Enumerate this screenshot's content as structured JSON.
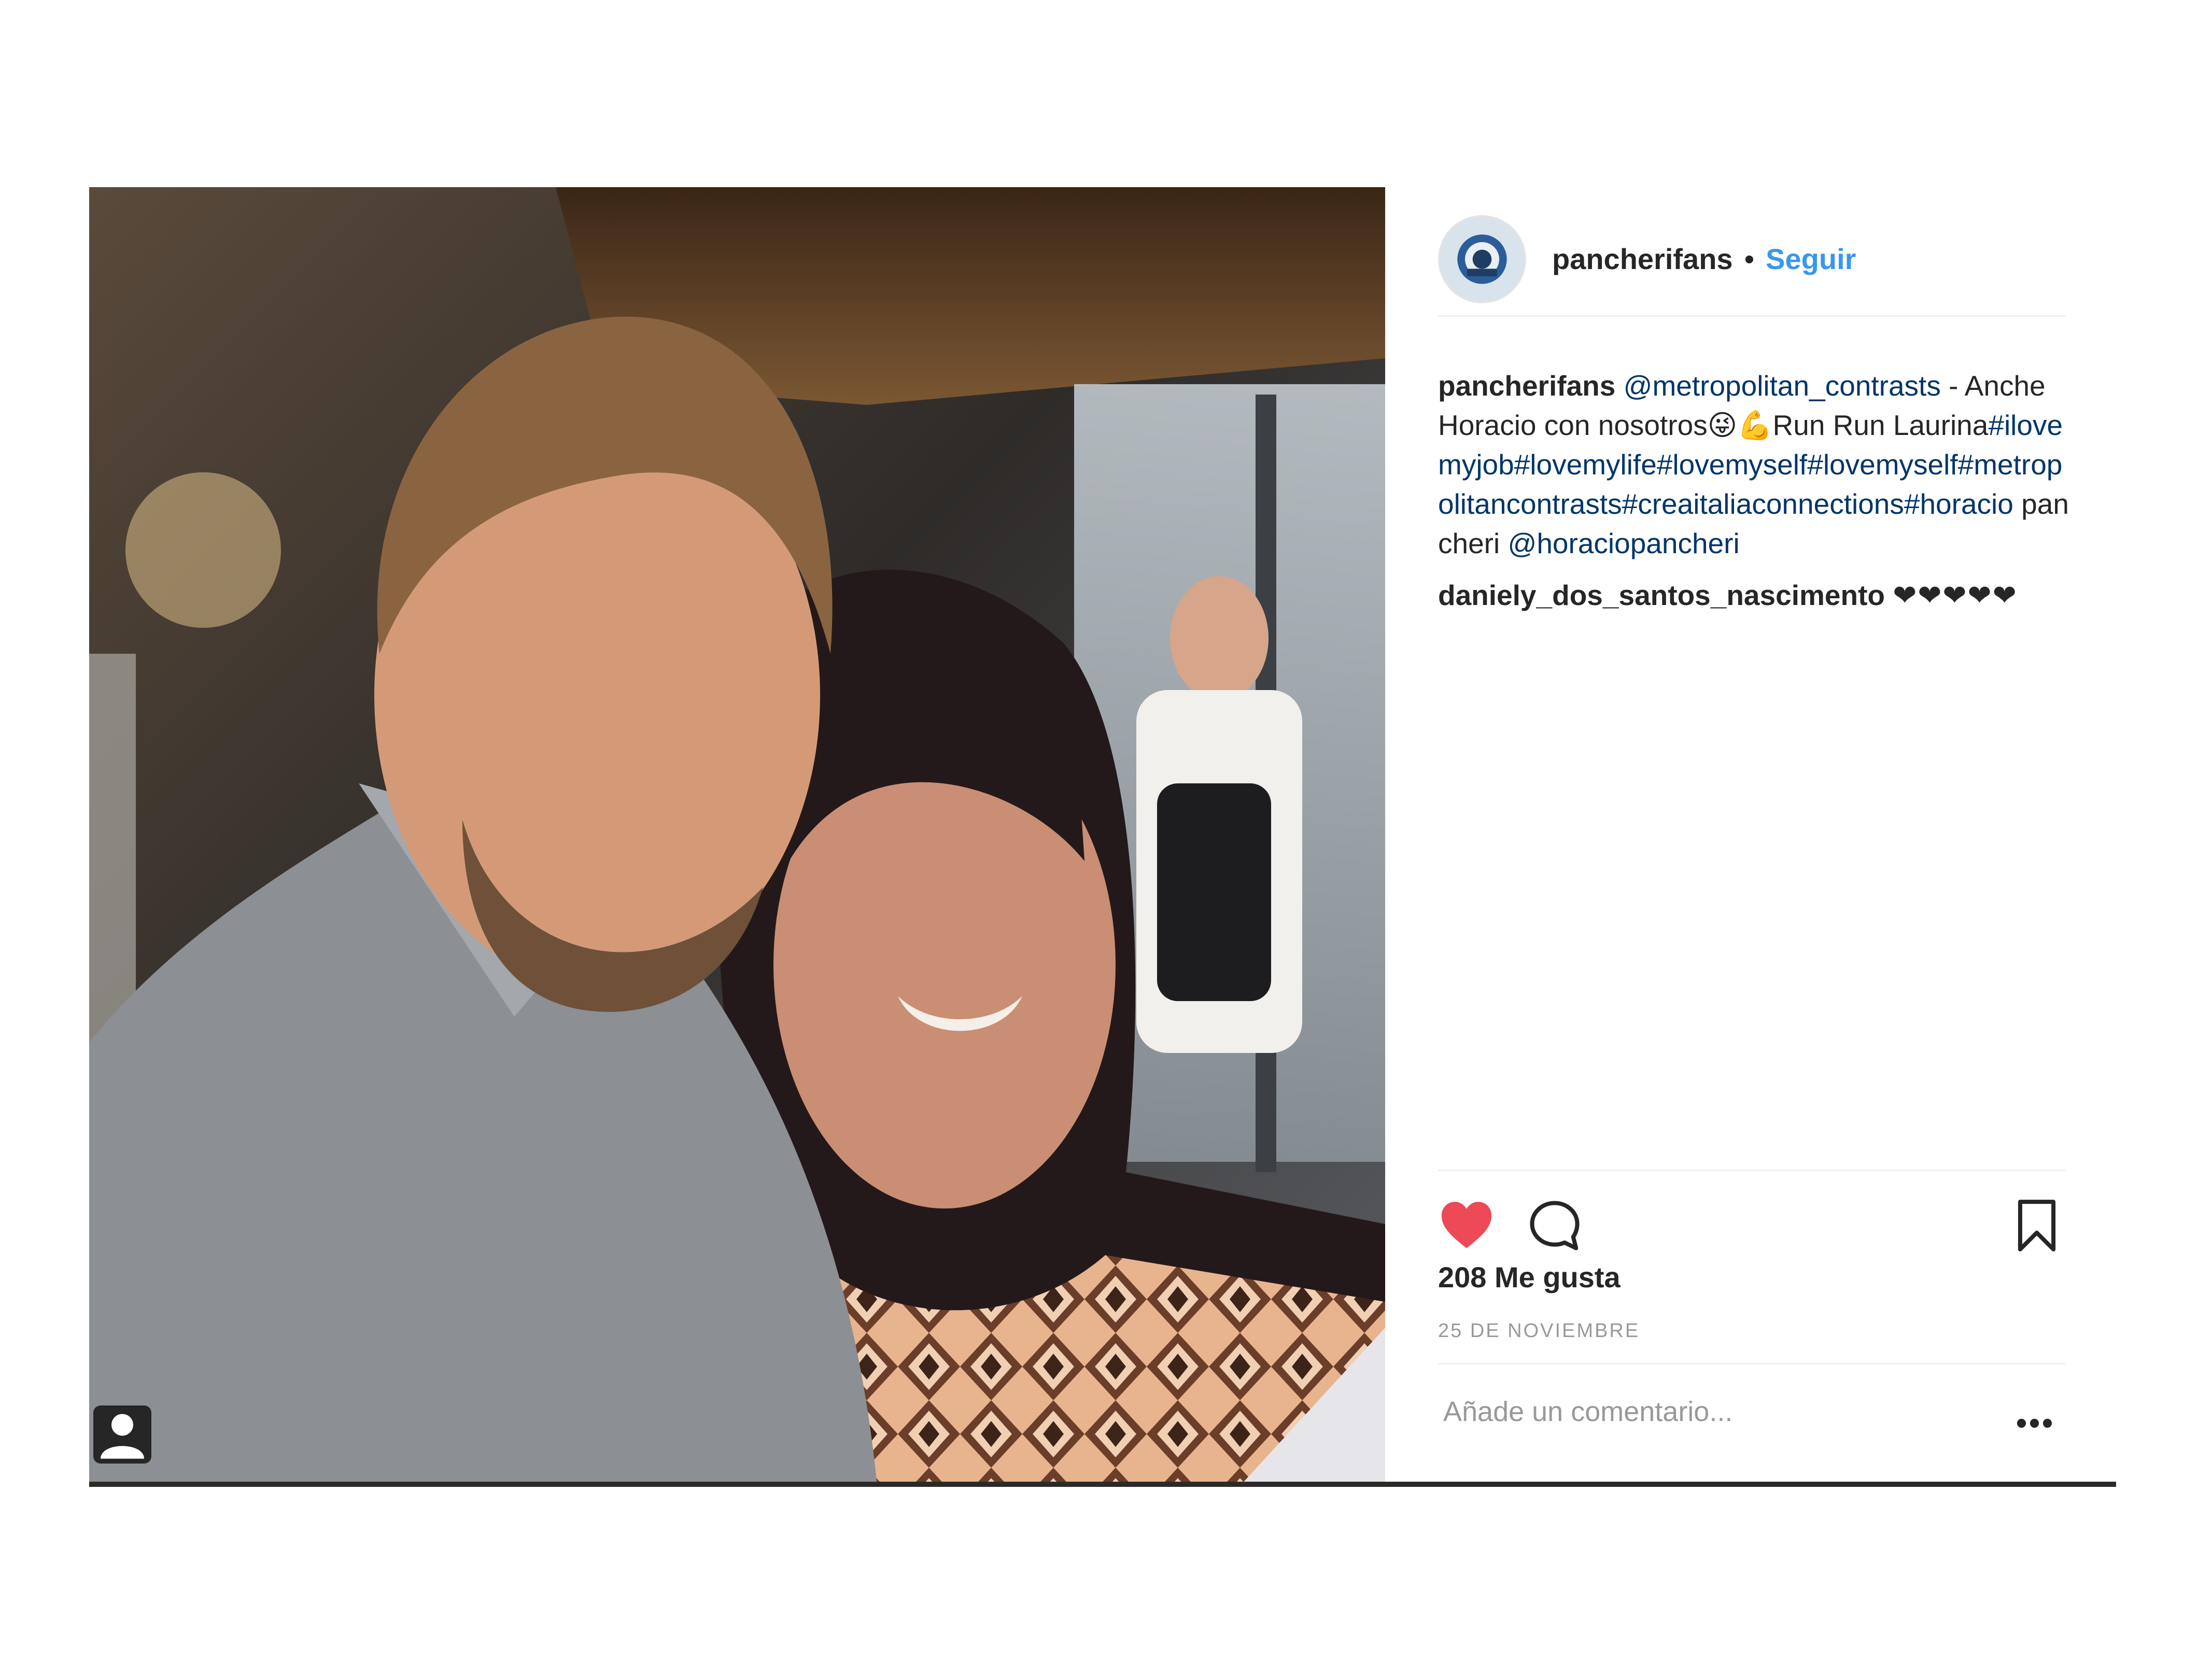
{
  "post": {
    "author": "pancherifans",
    "separator": "•",
    "follow_label": "Seguir",
    "caption": {
      "author": "pancherifans",
      "parts": [
        {
          "text": "@metropolitan_contrasts",
          "link": true
        },
        {
          "text": " - Anche Horacio con nosotros😜💪Run Run Laurina",
          "link": false
        },
        {
          "text": "#ilovemyjob",
          "link": true
        },
        {
          "text": "#lovemylife",
          "link": true
        },
        {
          "text": "#lovemyself#",
          "link": true
        },
        {
          "text": "lovemyself",
          "link": true
        },
        {
          "text": "#metropolitancontrasts",
          "link": true
        },
        {
          "text": "#creaitalia",
          "link": true
        },
        {
          "text": "connections",
          "link": true
        },
        {
          "text": "#horacio",
          "link": true
        },
        {
          "text": " pancheri ",
          "link": false
        },
        {
          "text": "@horaciopancheri",
          "link": true
        }
      ]
    },
    "comment": {
      "user": "daniely_dos_santos_nascimento",
      "text": "❤❤❤❤❤"
    },
    "likes": "208 Me gusta",
    "date": "25 DE NOVIEMBRE",
    "add_comment_placeholder": "Añade un comentario...",
    "more_label": "•••",
    "icons": {
      "like": "heart-icon",
      "comment": "speech-bubble-icon",
      "save": "bookmark-icon",
      "tag": "user-tag-icon"
    },
    "colors": {
      "like": "#ed4956",
      "link": "#003569",
      "follow": "#3897f0",
      "muted": "#999999"
    }
  }
}
